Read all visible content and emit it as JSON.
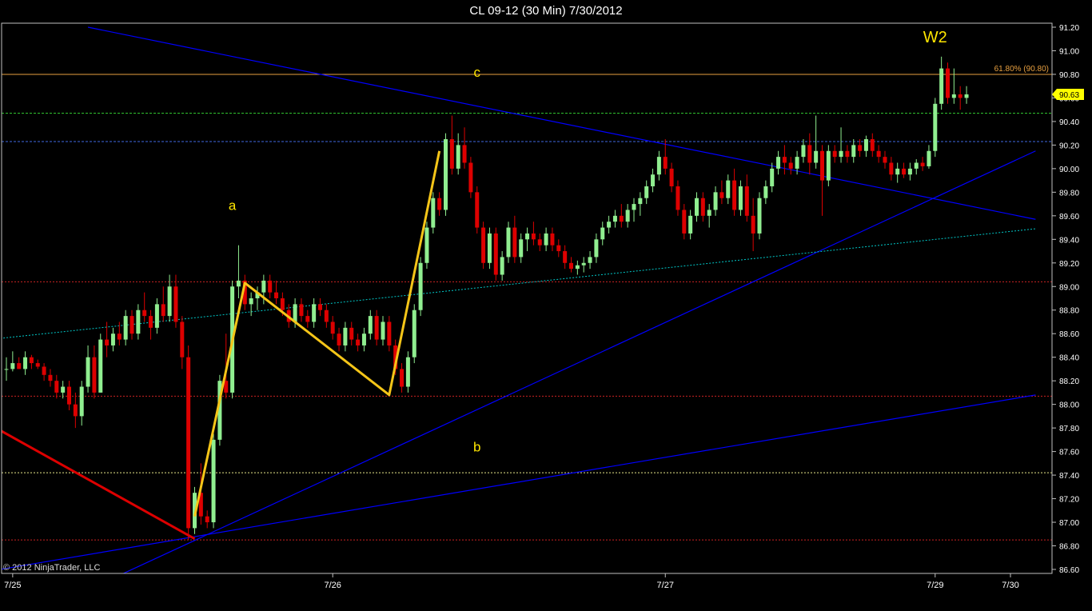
{
  "title": "CL 09-12 (30 Min)  7/30/2012",
  "copyright": "© 2012 NinjaTrader, LLC",
  "chart_data": {
    "type": "candlestick",
    "title": "CL 09-12 (30 Min)  7/30/2012",
    "ylim": [
      86.6,
      91.2
    ],
    "y_ticks": [
      "91.20",
      "91.00",
      "90.80",
      "90.60",
      "90.40",
      "90.20",
      "90.00",
      "89.80",
      "89.60",
      "89.40",
      "89.20",
      "89.00",
      "88.80",
      "88.60",
      "88.40",
      "88.20",
      "88.00",
      "87.80",
      "87.60",
      "87.40",
      "87.20",
      "87.00",
      "86.80",
      "86.60"
    ],
    "y_tick_values": [
      91.2,
      91.0,
      90.8,
      90.6,
      90.4,
      90.2,
      90.0,
      89.8,
      89.6,
      89.4,
      89.2,
      89.0,
      88.8,
      88.6,
      88.4,
      88.2,
      88.0,
      87.8,
      87.6,
      87.4,
      87.2,
      87.0,
      86.8,
      86.6
    ],
    "x_ticks": [
      {
        "label": "7/25",
        "bar": 1
      },
      {
        "label": "7/26",
        "bar": 52
      },
      {
        "label": "7/27",
        "bar": 105
      },
      {
        "label": "7/29",
        "bar": 148
      },
      {
        "label": "7/30",
        "bar": 160
      }
    ],
    "bar_count": 164,
    "last_price": "90.63",
    "last_price_value": 90.63,
    "colors": {
      "up": "#90ee90",
      "down": "#dd0000",
      "background": "#000000",
      "axis": "#c0c0c0",
      "wave": "#f5c518",
      "trend": "#0000ff",
      "label": "#ffe600"
    },
    "candles": [
      [
        88.3,
        88.4,
        88.2,
        88.3
      ],
      [
        88.3,
        88.45,
        88.28,
        88.35
      ],
      [
        88.35,
        88.4,
        88.3,
        88.3
      ],
      [
        88.3,
        88.45,
        88.25,
        88.4
      ],
      [
        88.4,
        88.42,
        88.3,
        88.35
      ],
      [
        88.35,
        88.38,
        88.3,
        88.32
      ],
      [
        88.32,
        88.35,
        88.2,
        88.25
      ],
      [
        88.25,
        88.3,
        88.15,
        88.2
      ],
      [
        88.2,
        88.25,
        88.05,
        88.1
      ],
      [
        88.1,
        88.2,
        88.05,
        88.15
      ],
      [
        88.15,
        88.2,
        87.95,
        88.0
      ],
      [
        88.0,
        88.1,
        87.8,
        87.9
      ],
      [
        87.9,
        88.2,
        87.82,
        88.15
      ],
      [
        88.15,
        88.5,
        88.1,
        88.4
      ],
      [
        88.4,
        88.5,
        88.05,
        88.1
      ],
      [
        88.1,
        88.6,
        88.1,
        88.55
      ],
      [
        88.55,
        88.7,
        88.4,
        88.5
      ],
      [
        88.5,
        88.65,
        88.45,
        88.6
      ],
      [
        88.6,
        88.7,
        88.5,
        88.55
      ],
      [
        88.55,
        88.8,
        88.5,
        88.75
      ],
      [
        88.75,
        88.8,
        88.55,
        88.6
      ],
      [
        88.6,
        88.85,
        88.55,
        88.8
      ],
      [
        88.8,
        88.95,
        88.7,
        88.75
      ],
      [
        88.75,
        88.8,
        88.55,
        88.65
      ],
      [
        88.65,
        88.9,
        88.6,
        88.85
      ],
      [
        88.85,
        89.0,
        88.7,
        88.75
      ],
      [
        88.75,
        89.1,
        88.7,
        89.0
      ],
      [
        89.0,
        89.1,
        88.65,
        88.7
      ],
      [
        88.7,
        88.75,
        88.3,
        88.4
      ],
      [
        88.4,
        88.5,
        86.85,
        86.95
      ],
      [
        86.95,
        87.3,
        86.9,
        87.25
      ],
      [
        87.25,
        87.5,
        86.98,
        87.05
      ],
      [
        87.05,
        87.1,
        86.95,
        87.0
      ],
      [
        87.0,
        87.75,
        86.95,
        87.7
      ],
      [
        87.7,
        88.25,
        87.65,
        88.2
      ],
      [
        88.2,
        88.6,
        88.05,
        88.1
      ],
      [
        88.1,
        89.05,
        88.05,
        89.0
      ],
      [
        89.0,
        89.35,
        88.9,
        89.05
      ],
      [
        89.05,
        89.1,
        88.8,
        88.85
      ],
      [
        88.85,
        88.95,
        88.75,
        88.9
      ],
      [
        88.9,
        89.0,
        88.8,
        88.95
      ],
      [
        88.95,
        89.1,
        88.85,
        89.05
      ],
      [
        89.05,
        89.1,
        88.9,
        88.95
      ],
      [
        88.95,
        89.05,
        88.85,
        88.9
      ],
      [
        88.9,
        88.95,
        88.75,
        88.8
      ],
      [
        88.8,
        88.85,
        88.65,
        88.7
      ],
      [
        88.7,
        88.9,
        88.65,
        88.85
      ],
      [
        88.85,
        88.9,
        88.7,
        88.75
      ],
      [
        88.75,
        88.8,
        88.65,
        88.7
      ],
      [
        88.7,
        88.9,
        88.65,
        88.85
      ],
      [
        88.85,
        88.9,
        88.75,
        88.8
      ],
      [
        88.8,
        88.85,
        88.65,
        88.7
      ],
      [
        88.7,
        88.75,
        88.55,
        88.6
      ],
      [
        88.6,
        88.65,
        88.45,
        88.5
      ],
      [
        88.5,
        88.7,
        88.45,
        88.65
      ],
      [
        88.65,
        88.7,
        88.5,
        88.55
      ],
      [
        88.55,
        88.6,
        88.45,
        88.5
      ],
      [
        88.5,
        88.65,
        88.45,
        88.6
      ],
      [
        88.6,
        88.8,
        88.55,
        88.75
      ],
      [
        88.75,
        88.8,
        88.5,
        88.55
      ],
      [
        88.55,
        88.75,
        88.5,
        88.7
      ],
      [
        88.7,
        88.75,
        88.45,
        88.5
      ],
      [
        88.5,
        88.55,
        88.25,
        88.3
      ],
      [
        88.3,
        88.35,
        88.1,
        88.15
      ],
      [
        88.15,
        88.45,
        88.1,
        88.4
      ],
      [
        88.4,
        88.85,
        88.35,
        88.8
      ],
      [
        88.8,
        89.25,
        88.75,
        89.2
      ],
      [
        89.2,
        89.55,
        89.15,
        89.5
      ],
      [
        89.5,
        89.8,
        89.45,
        89.75
      ],
      [
        89.75,
        89.8,
        89.6,
        89.65
      ],
      [
        89.65,
        90.3,
        89.6,
        90.25
      ],
      [
        90.25,
        90.45,
        89.95,
        90.0
      ],
      [
        90.0,
        90.3,
        89.95,
        90.2
      ],
      [
        90.2,
        90.35,
        90.0,
        90.05
      ],
      [
        90.05,
        90.1,
        89.75,
        89.8
      ],
      [
        89.8,
        89.85,
        89.45,
        89.5
      ],
      [
        89.5,
        89.55,
        89.15,
        89.2
      ],
      [
        89.2,
        89.5,
        89.15,
        89.45
      ],
      [
        89.45,
        89.5,
        89.05,
        89.1
      ],
      [
        89.1,
        89.3,
        89.05,
        89.25
      ],
      [
        89.25,
        89.55,
        89.2,
        89.5
      ],
      [
        89.5,
        89.6,
        89.2,
        89.25
      ],
      [
        89.25,
        89.45,
        89.2,
        89.4
      ],
      [
        89.4,
        89.5,
        89.3,
        89.45
      ],
      [
        89.45,
        89.55,
        89.35,
        89.4
      ],
      [
        89.4,
        89.45,
        89.3,
        89.35
      ],
      [
        89.35,
        89.5,
        89.3,
        89.45
      ],
      [
        89.45,
        89.5,
        89.3,
        89.35
      ],
      [
        89.35,
        89.4,
        89.25,
        89.3
      ],
      [
        89.3,
        89.35,
        89.15,
        89.2
      ],
      [
        89.2,
        89.25,
        89.12,
        89.15
      ],
      [
        89.15,
        89.22,
        89.1,
        89.18
      ],
      [
        89.18,
        89.25,
        89.12,
        89.2
      ],
      [
        89.2,
        89.3,
        89.15,
        89.25
      ],
      [
        89.25,
        89.45,
        89.2,
        89.4
      ],
      [
        89.4,
        89.55,
        89.35,
        89.5
      ],
      [
        89.5,
        89.6,
        89.45,
        89.55
      ],
      [
        89.55,
        89.65,
        89.5,
        89.6
      ],
      [
        89.6,
        89.7,
        89.5,
        89.55
      ],
      [
        89.55,
        89.7,
        89.5,
        89.65
      ],
      [
        89.65,
        89.75,
        89.55,
        89.7
      ],
      [
        89.7,
        89.8,
        89.6,
        89.75
      ],
      [
        89.75,
        89.9,
        89.7,
        89.85
      ],
      [
        89.85,
        90.0,
        89.8,
        89.95
      ],
      [
        89.95,
        90.15,
        89.9,
        90.1
      ],
      [
        90.1,
        90.25,
        89.95,
        90.0
      ],
      [
        90.0,
        90.05,
        89.8,
        89.85
      ],
      [
        89.85,
        89.9,
        89.6,
        89.65
      ],
      [
        89.65,
        89.7,
        89.4,
        89.45
      ],
      [
        89.45,
        89.65,
        89.4,
        89.6
      ],
      [
        89.6,
        89.8,
        89.55,
        89.75
      ],
      [
        89.75,
        89.8,
        89.55,
        89.6
      ],
      [
        89.6,
        89.7,
        89.5,
        89.65
      ],
      [
        89.65,
        89.85,
        89.6,
        89.8
      ],
      [
        89.8,
        89.9,
        89.7,
        89.75
      ],
      [
        89.75,
        89.95,
        89.7,
        89.9
      ],
      [
        89.9,
        90.0,
        89.6,
        89.65
      ],
      [
        89.65,
        89.9,
        89.6,
        89.85
      ],
      [
        89.85,
        89.95,
        89.55,
        89.6
      ],
      [
        89.6,
        89.75,
        89.3,
        89.45
      ],
      [
        89.45,
        89.8,
        89.4,
        89.75
      ],
      [
        89.75,
        89.9,
        89.7,
        89.85
      ],
      [
        89.85,
        90.05,
        89.8,
        90.0
      ],
      [
        90.0,
        90.15,
        89.95,
        90.1
      ],
      [
        90.1,
        90.2,
        89.95,
        90.05
      ],
      [
        90.05,
        90.1,
        89.95,
        90.0
      ],
      [
        90.0,
        90.15,
        89.95,
        90.1
      ],
      [
        90.1,
        90.25,
        90.05,
        90.2
      ],
      [
        90.2,
        90.3,
        89.95,
        90.05
      ],
      [
        90.05,
        90.45,
        90.0,
        90.15
      ],
      [
        90.15,
        90.2,
        89.6,
        89.9
      ],
      [
        89.9,
        90.2,
        89.85,
        90.15
      ],
      [
        90.15,
        90.2,
        90.05,
        90.1
      ],
      [
        90.1,
        90.35,
        90.05,
        90.15
      ],
      [
        90.15,
        90.2,
        90.05,
        90.1
      ],
      [
        90.1,
        90.25,
        90.05,
        90.2
      ],
      [
        90.2,
        90.25,
        90.1,
        90.15
      ],
      [
        90.15,
        90.28,
        90.1,
        90.25
      ],
      [
        90.25,
        90.3,
        90.1,
        90.15
      ],
      [
        90.15,
        90.2,
        90.05,
        90.1
      ],
      [
        90.1,
        90.15,
        90.0,
        90.05
      ],
      [
        90.05,
        90.1,
        89.9,
        89.95
      ],
      [
        89.95,
        90.05,
        89.88,
        90.0
      ],
      [
        90.0,
        90.05,
        89.92,
        89.95
      ],
      [
        89.95,
        90.05,
        89.9,
        90.0
      ],
      [
        90.0,
        90.08,
        89.95,
        90.05
      ],
      [
        90.05,
        90.1,
        89.98,
        90.02
      ],
      [
        90.02,
        90.2,
        90.0,
        90.15
      ],
      [
        90.15,
        90.6,
        90.1,
        90.55
      ],
      [
        90.55,
        90.95,
        90.5,
        90.85
      ],
      [
        90.85,
        90.9,
        90.55,
        90.6
      ],
      [
        90.6,
        90.85,
        90.55,
        90.63
      ],
      [
        90.63,
        90.7,
        90.5,
        90.6
      ],
      [
        90.6,
        90.7,
        90.55,
        90.63
      ]
    ],
    "levels": [
      {
        "value": 90.8,
        "color": "#e8a040",
        "dash": "none",
        "label": "61.80% (90.80)"
      },
      {
        "value": 90.47,
        "color": "#32cd32",
        "dash": "3,2",
        "label": ""
      },
      {
        "value": 90.23,
        "color": "#4169e1",
        "dash": "3,2",
        "label": ""
      },
      {
        "value": 89.04,
        "color": "#cc2222",
        "dash": "2,2",
        "label": ""
      },
      {
        "value": 88.07,
        "color": "#cc2222",
        "dash": "2,2",
        "label": ""
      },
      {
        "value": 87.42,
        "color": "#e8e88a",
        "dash": "2,2",
        "label": ""
      },
      {
        "value": 86.85,
        "color": "#cc2222",
        "dash": "2,2",
        "label": ""
      }
    ],
    "trend_lines": [
      {
        "color": "#0000ff",
        "width": 1.2,
        "p1": [
          13,
          91.2
        ],
        "p2": [
          164,
          89.57
        ]
      },
      {
        "color": "#0000ff",
        "width": 1.2,
        "p1": [
          18,
          86.55
        ],
        "p2": [
          164,
          90.15
        ]
      },
      {
        "color": "#0000ff",
        "width": 1.2,
        "p1": [
          -1,
          86.6
        ],
        "p2": [
          164,
          88.08
        ]
      },
      {
        "color": "#00c8c8",
        "width": 1,
        "dash": "2,2",
        "p1": [
          -1,
          88.56
        ],
        "p2": [
          164,
          89.49
        ]
      },
      {
        "color": "#dd0000",
        "width": 3,
        "p1": [
          -1,
          87.78
        ],
        "p2": [
          30,
          86.86
        ]
      }
    ],
    "wave_path": [
      [
        30,
        87.05
      ],
      [
        38,
        89.03
      ],
      [
        61,
        88.08
      ],
      [
        69,
        90.15
      ]
    ],
    "annotations": [
      {
        "text": "W2",
        "bar": 148,
        "value": 91.07
      },
      {
        "text": "c",
        "bar": 75,
        "value": 90.78
      },
      {
        "text": "a",
        "bar": 36,
        "value": 89.65
      },
      {
        "text": "b",
        "bar": 75,
        "value": 87.6
      }
    ]
  }
}
